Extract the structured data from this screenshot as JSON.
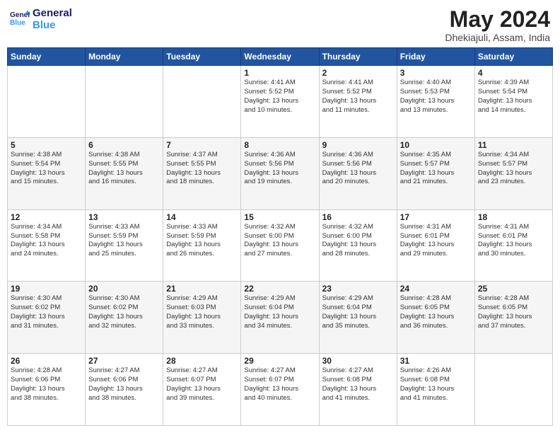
{
  "logo": {
    "line1": "General",
    "line2": "Blue"
  },
  "title": "May 2024",
  "location": "Dhekiajuli, Assam, India",
  "headers": [
    "Sunday",
    "Monday",
    "Tuesday",
    "Wednesday",
    "Thursday",
    "Friday",
    "Saturday"
  ],
  "weeks": [
    [
      {
        "day": "",
        "info": ""
      },
      {
        "day": "",
        "info": ""
      },
      {
        "day": "",
        "info": ""
      },
      {
        "day": "1",
        "info": "Sunrise: 4:41 AM\nSunset: 5:52 PM\nDaylight: 13 hours\nand 10 minutes."
      },
      {
        "day": "2",
        "info": "Sunrise: 4:41 AM\nSunset: 5:52 PM\nDaylight: 13 hours\nand 11 minutes."
      },
      {
        "day": "3",
        "info": "Sunrise: 4:40 AM\nSunset: 5:53 PM\nDaylight: 13 hours\nand 13 minutes."
      },
      {
        "day": "4",
        "info": "Sunrise: 4:39 AM\nSunset: 5:54 PM\nDaylight: 13 hours\nand 14 minutes."
      }
    ],
    [
      {
        "day": "5",
        "info": "Sunrise: 4:38 AM\nSunset: 5:54 PM\nDaylight: 13 hours\nand 15 minutes."
      },
      {
        "day": "6",
        "info": "Sunrise: 4:38 AM\nSunset: 5:55 PM\nDaylight: 13 hours\nand 16 minutes."
      },
      {
        "day": "7",
        "info": "Sunrise: 4:37 AM\nSunset: 5:55 PM\nDaylight: 13 hours\nand 18 minutes."
      },
      {
        "day": "8",
        "info": "Sunrise: 4:36 AM\nSunset: 5:56 PM\nDaylight: 13 hours\nand 19 minutes."
      },
      {
        "day": "9",
        "info": "Sunrise: 4:36 AM\nSunset: 5:56 PM\nDaylight: 13 hours\nand 20 minutes."
      },
      {
        "day": "10",
        "info": "Sunrise: 4:35 AM\nSunset: 5:57 PM\nDaylight: 13 hours\nand 21 minutes."
      },
      {
        "day": "11",
        "info": "Sunrise: 4:34 AM\nSunset: 5:57 PM\nDaylight: 13 hours\nand 23 minutes."
      }
    ],
    [
      {
        "day": "12",
        "info": "Sunrise: 4:34 AM\nSunset: 5:58 PM\nDaylight: 13 hours\nand 24 minutes."
      },
      {
        "day": "13",
        "info": "Sunrise: 4:33 AM\nSunset: 5:59 PM\nDaylight: 13 hours\nand 25 minutes."
      },
      {
        "day": "14",
        "info": "Sunrise: 4:33 AM\nSunset: 5:59 PM\nDaylight: 13 hours\nand 26 minutes."
      },
      {
        "day": "15",
        "info": "Sunrise: 4:32 AM\nSunset: 6:00 PM\nDaylight: 13 hours\nand 27 minutes."
      },
      {
        "day": "16",
        "info": "Sunrise: 4:32 AM\nSunset: 6:00 PM\nDaylight: 13 hours\nand 28 minutes."
      },
      {
        "day": "17",
        "info": "Sunrise: 4:31 AM\nSunset: 6:01 PM\nDaylight: 13 hours\nand 29 minutes."
      },
      {
        "day": "18",
        "info": "Sunrise: 4:31 AM\nSunset: 6:01 PM\nDaylight: 13 hours\nand 30 minutes."
      }
    ],
    [
      {
        "day": "19",
        "info": "Sunrise: 4:30 AM\nSunset: 6:02 PM\nDaylight: 13 hours\nand 31 minutes."
      },
      {
        "day": "20",
        "info": "Sunrise: 4:30 AM\nSunset: 6:02 PM\nDaylight: 13 hours\nand 32 minutes."
      },
      {
        "day": "21",
        "info": "Sunrise: 4:29 AM\nSunset: 6:03 PM\nDaylight: 13 hours\nand 33 minutes."
      },
      {
        "day": "22",
        "info": "Sunrise: 4:29 AM\nSunset: 6:04 PM\nDaylight: 13 hours\nand 34 minutes."
      },
      {
        "day": "23",
        "info": "Sunrise: 4:29 AM\nSunset: 6:04 PM\nDaylight: 13 hours\nand 35 minutes."
      },
      {
        "day": "24",
        "info": "Sunrise: 4:28 AM\nSunset: 6:05 PM\nDaylight: 13 hours\nand 36 minutes."
      },
      {
        "day": "25",
        "info": "Sunrise: 4:28 AM\nSunset: 6:05 PM\nDaylight: 13 hours\nand 37 minutes."
      }
    ],
    [
      {
        "day": "26",
        "info": "Sunrise: 4:28 AM\nSunset: 6:06 PM\nDaylight: 13 hours\nand 38 minutes."
      },
      {
        "day": "27",
        "info": "Sunrise: 4:27 AM\nSunset: 6:06 PM\nDaylight: 13 hours\nand 38 minutes."
      },
      {
        "day": "28",
        "info": "Sunrise: 4:27 AM\nSunset: 6:07 PM\nDaylight: 13 hours\nand 39 minutes."
      },
      {
        "day": "29",
        "info": "Sunrise: 4:27 AM\nSunset: 6:07 PM\nDaylight: 13 hours\nand 40 minutes."
      },
      {
        "day": "30",
        "info": "Sunrise: 4:27 AM\nSunset: 6:08 PM\nDaylight: 13 hours\nand 41 minutes."
      },
      {
        "day": "31",
        "info": "Sunrise: 4:26 AM\nSunset: 6:08 PM\nDaylight: 13 hours\nand 41 minutes."
      },
      {
        "day": "",
        "info": ""
      }
    ]
  ]
}
